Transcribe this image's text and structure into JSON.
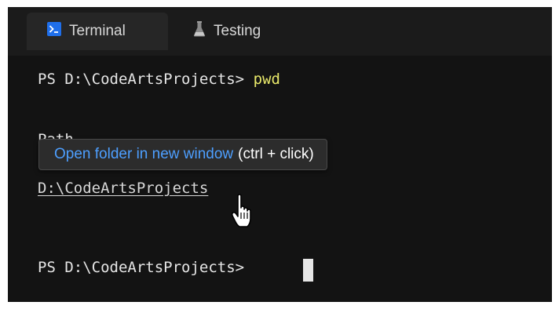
{
  "tabs": {
    "terminal_label": "Terminal",
    "testing_label": "Testing"
  },
  "terminal": {
    "prompt1": "PS D:\\CodeArtsProjects>",
    "command1": "pwd",
    "header": "Path",
    "path_value": "D:\\CodeArtsProjects",
    "prompt2": "PS D:\\CodeArtsProjects>"
  },
  "tooltip": {
    "link_text": "Open folder in new window",
    "hint_text": "(ctrl + click)"
  },
  "icons": {
    "terminal_tab_icon": "terminal-icon",
    "testing_tab_icon": "flask-icon",
    "cursor_icon": "hand-pointer-icon"
  },
  "colors": {
    "command": "#e8e86a",
    "tooltip_link": "#4d9fff",
    "terminal_icon_bg": "#1f6feb"
  }
}
